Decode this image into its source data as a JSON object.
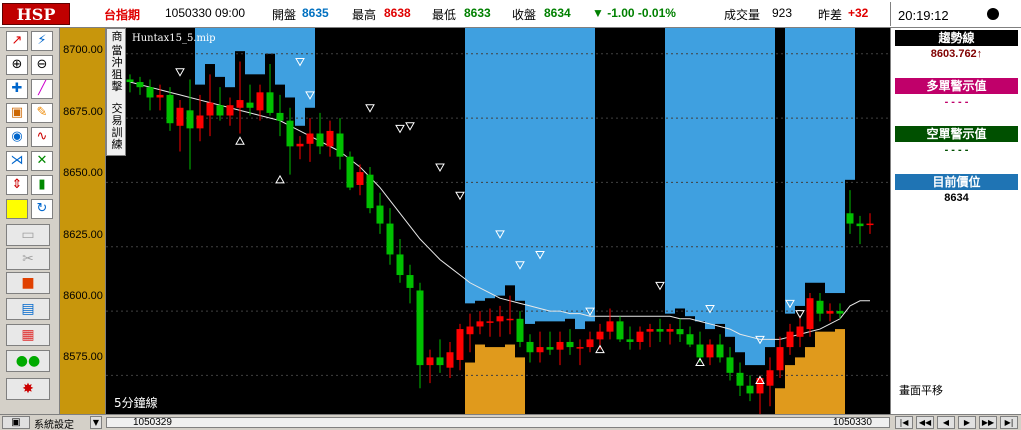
{
  "header": {
    "logo": "HSP",
    "symbol": "台指期",
    "date_time": "1050330  09:00",
    "open_label": "開盤",
    "open_value": "8635",
    "high_label": "最高",
    "high_value": "8638",
    "low_label": "最低",
    "low_value": "8633",
    "close_label": "收盤",
    "close_value": "8634",
    "change": "▼ -1.00  -0.01%",
    "volume_label": "成交量",
    "volume_value": "923",
    "diff_label": "昨差",
    "diff_value": "+32",
    "clock": "20:19:12"
  },
  "chart_info": {
    "file_label": "Huntax15_5.mip",
    "period_label": "5分鐘線",
    "strategy_menu": [
      "商",
      "當沖狙擊",
      "交易訓練"
    ]
  },
  "y_axis": {
    "ticks": [
      "8700.00",
      "8675.00",
      "8650.00",
      "8625.00",
      "8600.00",
      "8575.00"
    ]
  },
  "right_panel": {
    "trend_title": "趨勢線",
    "trend_value": "8603.762↑",
    "long_title": "多單警示值",
    "long_value": "- - - -",
    "short_title": "空單警示值",
    "short_value": "- - - -",
    "position_title": "目前價位",
    "position_value": "8634",
    "pan_label": "畫面平移"
  },
  "bottom_bar": {
    "sys_button": "系統設定",
    "start_date": "1050329",
    "end_date": "1050330"
  },
  "colors": {
    "bull": "#ff0000",
    "bear": "#00c000",
    "blue_zone": "#3fa0e0",
    "orange_zone": "#e09a1c",
    "chart_bg": "#000000",
    "axis_bg": "#c8960c"
  },
  "chart_data": {
    "type": "candlestick",
    "title": "",
    "xlabel": "",
    "ylabel": "",
    "ylim": [
      8560,
      8710
    ],
    "x_range": [
      "1050329",
      "1050330"
    ],
    "candles": [
      {
        "o": 8690,
        "h": 8692,
        "l": 8685,
        "c": 8689
      },
      {
        "o": 8689,
        "h": 8691,
        "l": 8684,
        "c": 8687
      },
      {
        "o": 8687,
        "h": 8690,
        "l": 8678,
        "c": 8683
      },
      {
        "o": 8683,
        "h": 8688,
        "l": 8678,
        "c": 8684
      },
      {
        "o": 8684,
        "h": 8687,
        "l": 8670,
        "c": 8673
      },
      {
        "o": 8672,
        "h": 8682,
        "l": 8662,
        "c": 8679
      },
      {
        "o": 8678,
        "h": 8690,
        "l": 8655,
        "c": 8671
      },
      {
        "o": 8671,
        "h": 8684,
        "l": 8666,
        "c": 8676
      },
      {
        "o": 8676,
        "h": 8692,
        "l": 8668,
        "c": 8681
      },
      {
        "o": 8680,
        "h": 8687,
        "l": 8674,
        "c": 8676
      },
      {
        "o": 8676,
        "h": 8683,
        "l": 8672,
        "c": 8680
      },
      {
        "o": 8679,
        "h": 8697,
        "l": 8669,
        "c": 8682
      },
      {
        "o": 8681,
        "h": 8688,
        "l": 8676,
        "c": 8679
      },
      {
        "o": 8678,
        "h": 8688,
        "l": 8674,
        "c": 8685
      },
      {
        "o": 8685,
        "h": 8696,
        "l": 8676,
        "c": 8677
      },
      {
        "o": 8677,
        "h": 8684,
        "l": 8668,
        "c": 8674
      },
      {
        "o": 8674,
        "h": 8679,
        "l": 8653,
        "c": 8664
      },
      {
        "o": 8664,
        "h": 8668,
        "l": 8659,
        "c": 8665
      },
      {
        "o": 8665,
        "h": 8675,
        "l": 8658,
        "c": 8669
      },
      {
        "o": 8669,
        "h": 8677,
        "l": 8661,
        "c": 8664
      },
      {
        "o": 8664,
        "h": 8674,
        "l": 8660,
        "c": 8670
      },
      {
        "o": 8669,
        "h": 8675,
        "l": 8655,
        "c": 8660
      },
      {
        "o": 8660,
        "h": 8662,
        "l": 8647,
        "c": 8648
      },
      {
        "o": 8649,
        "h": 8657,
        "l": 8645,
        "c": 8654
      },
      {
        "o": 8653,
        "h": 8656,
        "l": 8638,
        "c": 8640
      },
      {
        "o": 8641,
        "h": 8646,
        "l": 8630,
        "c": 8634
      },
      {
        "o": 8634,
        "h": 8640,
        "l": 8618,
        "c": 8622
      },
      {
        "o": 8622,
        "h": 8628,
        "l": 8611,
        "c": 8614
      },
      {
        "o": 8614,
        "h": 8618,
        "l": 8603,
        "c": 8609
      },
      {
        "o": 8608,
        "h": 8611,
        "l": 8570,
        "c": 8579
      },
      {
        "o": 8579,
        "h": 8585,
        "l": 8572,
        "c": 8582
      },
      {
        "o": 8582,
        "h": 8589,
        "l": 8576,
        "c": 8579
      },
      {
        "o": 8578,
        "h": 8588,
        "l": 8574,
        "c": 8584
      },
      {
        "o": 8581,
        "h": 8595,
        "l": 8577,
        "c": 8593
      },
      {
        "o": 8591,
        "h": 8599,
        "l": 8584,
        "c": 8594
      },
      {
        "o": 8594,
        "h": 8600,
        "l": 8591,
        "c": 8596
      },
      {
        "o": 8596,
        "h": 8601,
        "l": 8590,
        "c": 8596
      },
      {
        "o": 8596,
        "h": 8602,
        "l": 8590,
        "c": 8598
      },
      {
        "o": 8597,
        "h": 8606,
        "l": 8591,
        "c": 8597
      },
      {
        "o": 8597,
        "h": 8600,
        "l": 8586,
        "c": 8588
      },
      {
        "o": 8588,
        "h": 8591,
        "l": 8580,
        "c": 8584
      },
      {
        "o": 8584,
        "h": 8592,
        "l": 8580,
        "c": 8586
      },
      {
        "o": 8586,
        "h": 8592,
        "l": 8583,
        "c": 8585
      },
      {
        "o": 8585,
        "h": 8592,
        "l": 8579,
        "c": 8588
      },
      {
        "o": 8588,
        "h": 8593,
        "l": 8583,
        "c": 8586
      },
      {
        "o": 8586,
        "h": 8589,
        "l": 8579,
        "c": 8586
      },
      {
        "o": 8586,
        "h": 8592,
        "l": 8584,
        "c": 8589
      },
      {
        "o": 8589,
        "h": 8595,
        "l": 8585,
        "c": 8592
      },
      {
        "o": 8592,
        "h": 8601,
        "l": 8589,
        "c": 8596
      },
      {
        "o": 8596,
        "h": 8598,
        "l": 8588,
        "c": 8589
      },
      {
        "o": 8589,
        "h": 8594,
        "l": 8585,
        "c": 8588
      },
      {
        "o": 8588,
        "h": 8594,
        "l": 8585,
        "c": 8592
      },
      {
        "o": 8592,
        "h": 8595,
        "l": 8586,
        "c": 8593
      },
      {
        "o": 8593,
        "h": 8597,
        "l": 8588,
        "c": 8592
      },
      {
        "o": 8592,
        "h": 8595,
        "l": 8587,
        "c": 8593
      },
      {
        "o": 8593,
        "h": 8597,
        "l": 8588,
        "c": 8591
      },
      {
        "o": 8591,
        "h": 8594,
        "l": 8586,
        "c": 8587
      },
      {
        "o": 8587,
        "h": 8592,
        "l": 8580,
        "c": 8582
      },
      {
        "o": 8582,
        "h": 8589,
        "l": 8579,
        "c": 8587
      },
      {
        "o": 8587,
        "h": 8591,
        "l": 8580,
        "c": 8582
      },
      {
        "o": 8582,
        "h": 8586,
        "l": 8573,
        "c": 8576
      },
      {
        "o": 8576,
        "h": 8580,
        "l": 8567,
        "c": 8571
      },
      {
        "o": 8571,
        "h": 8575,
        "l": 8565,
        "c": 8568
      },
      {
        "o": 8568,
        "h": 8575,
        "l": 8559,
        "c": 8574
      },
      {
        "o": 8571,
        "h": 8582,
        "l": 8563,
        "c": 8577
      },
      {
        "o": 8577,
        "h": 8590,
        "l": 8574,
        "c": 8586
      },
      {
        "o": 8586,
        "h": 8595,
        "l": 8583,
        "c": 8592
      },
      {
        "o": 8590,
        "h": 8598,
        "l": 8586,
        "c": 8594
      },
      {
        "o": 8593,
        "h": 8607,
        "l": 8590,
        "c": 8605
      },
      {
        "o": 8604,
        "h": 8607,
        "l": 8596,
        "c": 8599
      },
      {
        "o": 8599,
        "h": 8603,
        "l": 8596,
        "c": 8600
      },
      {
        "o": 8600,
        "h": 8603,
        "l": 8597,
        "c": 8599
      },
      {
        "o": 8638,
        "h": 8647,
        "l": 8630,
        "c": 8634
      },
      {
        "o": 8634,
        "h": 8637,
        "l": 8626,
        "c": 8633
      },
      {
        "o": 8634,
        "h": 8638,
        "l": 8630,
        "c": 8634
      }
    ],
    "trend_line": [
      8689,
      8688,
      8687,
      8686,
      8685,
      8684,
      8683,
      8682,
      8681,
      8680,
      8679,
      8678,
      8677,
      8676,
      8675,
      8674,
      8672,
      8670,
      8668,
      8666,
      8664,
      8662,
      8659,
      8656,
      8652,
      8648,
      8643,
      8638,
      8633,
      8628,
      8624,
      8620,
      8617,
      8614,
      8611,
      8609,
      8607,
      8605,
      8604,
      8603,
      8602,
      8601,
      8600,
      8600,
      8599,
      8599,
      8598,
      8598,
      8598,
      8598,
      8598,
      8598,
      8598,
      8598,
      8598,
      8597,
      8597,
      8596,
      8595,
      8594,
      8593,
      8591,
      8590,
      8589,
      8589,
      8589,
      8590,
      8591,
      8592,
      8593,
      8595,
      8597,
      8602,
      8604,
      8604
    ],
    "blue_zones": [
      [
        7,
        18
      ],
      [
        34,
        46
      ],
      [
        54,
        64
      ],
      [
        66,
        72
      ]
    ],
    "orange_zones": [
      [
        34,
        39
      ],
      [
        64,
        71
      ]
    ],
    "down_signals": [
      [
        5,
        8693
      ],
      [
        17,
        8697
      ],
      [
        18,
        8684
      ],
      [
        24,
        8679
      ],
      [
        27,
        8671
      ],
      [
        28,
        8672
      ],
      [
        31,
        8656
      ],
      [
        33,
        8645
      ],
      [
        37,
        8630
      ],
      [
        39,
        8618
      ],
      [
        41,
        8622
      ],
      [
        46,
        8600
      ],
      [
        53,
        8610
      ],
      [
        58,
        8601
      ],
      [
        63,
        8589
      ],
      [
        66,
        8603
      ],
      [
        67,
        8599
      ]
    ],
    "up_signals": [
      [
        11,
        8666
      ],
      [
        15,
        8651
      ],
      [
        47,
        8585
      ],
      [
        57,
        8580
      ],
      [
        63,
        8573
      ]
    ]
  }
}
